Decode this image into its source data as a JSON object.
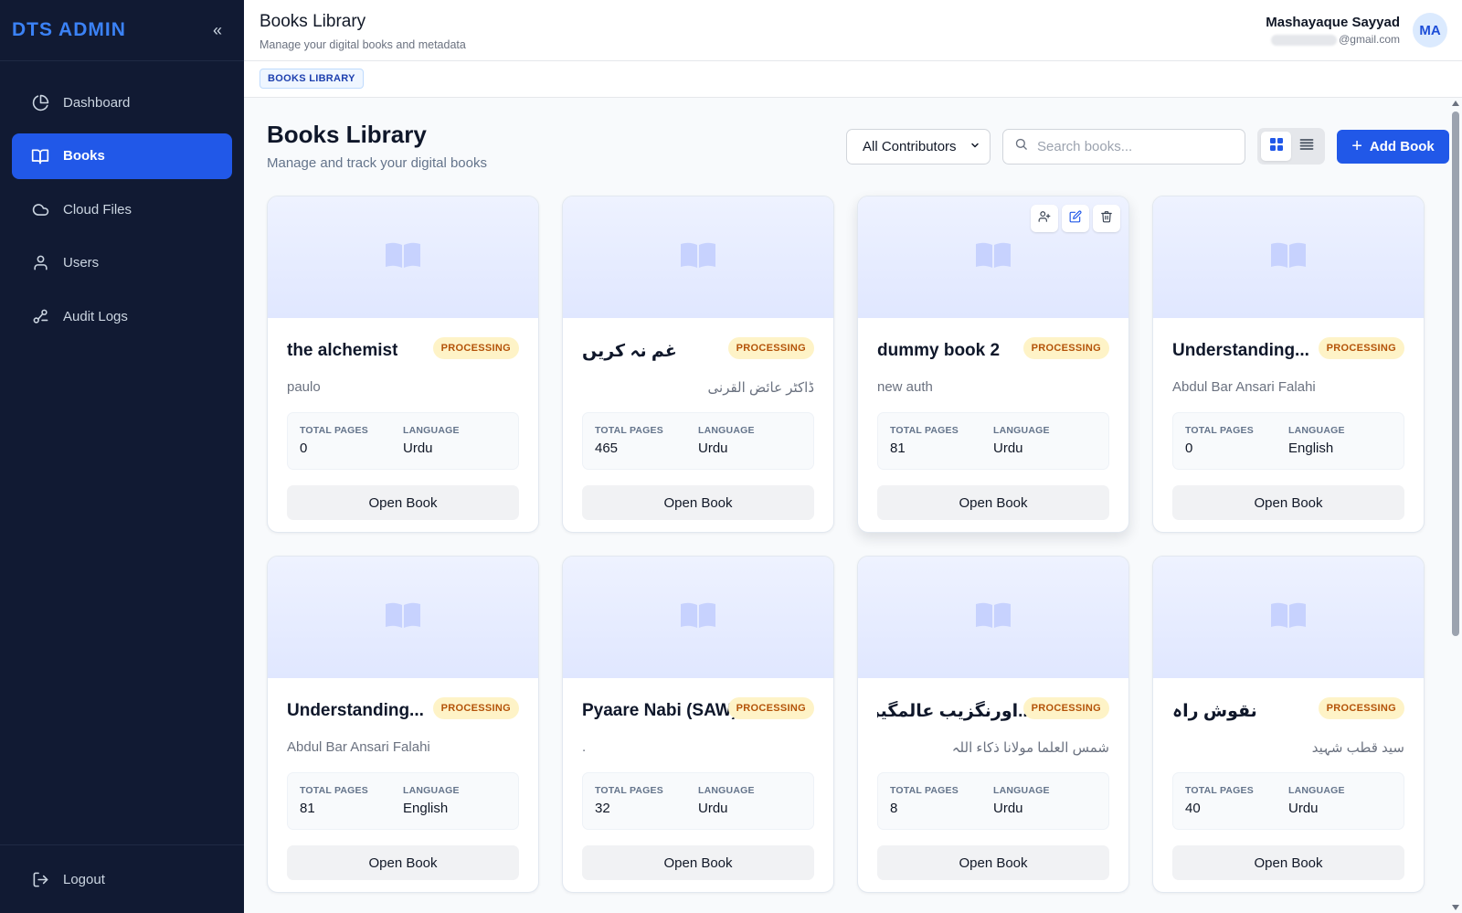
{
  "sidebar": {
    "brand": "DTS ADMIN",
    "collapse_glyph": "«",
    "items": [
      {
        "label": "Dashboard",
        "icon": "pie-chart-icon"
      },
      {
        "label": "Books",
        "icon": "book-open-icon",
        "active": true
      },
      {
        "label": "Cloud Files",
        "icon": "cloud-icon"
      },
      {
        "label": "Users",
        "icon": "users-icon"
      },
      {
        "label": "Audit Logs",
        "icon": "activity-icon"
      }
    ],
    "logout_label": "Logout"
  },
  "header": {
    "title": "Books Library",
    "subtitle": "Manage your digital books and metadata",
    "user_name": "Mashayaque Sayyad",
    "user_email": "@gmail.com",
    "avatar_initials": "MA"
  },
  "breadcrumb": {
    "label": "BOOKS LIBRARY"
  },
  "main": {
    "title": "Books Library",
    "subtitle": "Manage and track your digital books",
    "contributor_filter": "All Contributors",
    "search_placeholder": "Search books...",
    "add_label": "Add Book"
  },
  "card_labels": {
    "total_pages": "TOTAL PAGES",
    "language": "LANGUAGE",
    "open": "Open Book"
  },
  "books": [
    {
      "title": "the alchemist",
      "author": "paulo",
      "status": "PROCESSING",
      "pages": "0",
      "language": "Urdu"
    },
    {
      "title": "غم نہ کریں",
      "author": "ڈاکٹر عائض القرنی",
      "status": "PROCESSING",
      "pages": "465",
      "language": "Urdu",
      "rtl": true
    },
    {
      "title": "dummy book 2",
      "author": "new auth",
      "status": "PROCESSING",
      "pages": "81",
      "language": "Urdu",
      "hovered": true
    },
    {
      "title": "Understanding...",
      "author": "Abdul Bar Ansari Falahi",
      "status": "PROCESSING",
      "pages": "0",
      "language": "English"
    },
    {
      "title": "Understanding...",
      "author": "Abdul Bar Ansari Falahi",
      "status": "PROCESSING",
      "pages": "81",
      "language": "English"
    },
    {
      "title": "Pyaare Nabi (SAW)",
      "author": ".",
      "status": "PROCESSING",
      "pages": "32",
      "language": "Urdu"
    },
    {
      "title": "...اورنگزیب عالمگیر",
      "author": "شمس العلما مولانا ذکاء اللہ",
      "status": "PROCESSING",
      "pages": "8",
      "language": "Urdu",
      "rtl": true
    },
    {
      "title": "نقوش راہ",
      "author": "سید قطب شہید",
      "status": "PROCESSING",
      "pages": "40",
      "language": "Urdu",
      "rtl": true
    }
  ],
  "colors": {
    "sidebar_bg": "#111a33",
    "accent": "#2158e8",
    "brand": "#3b82f6",
    "badge_bg": "#fef3c7",
    "badge_text": "#b45309"
  }
}
